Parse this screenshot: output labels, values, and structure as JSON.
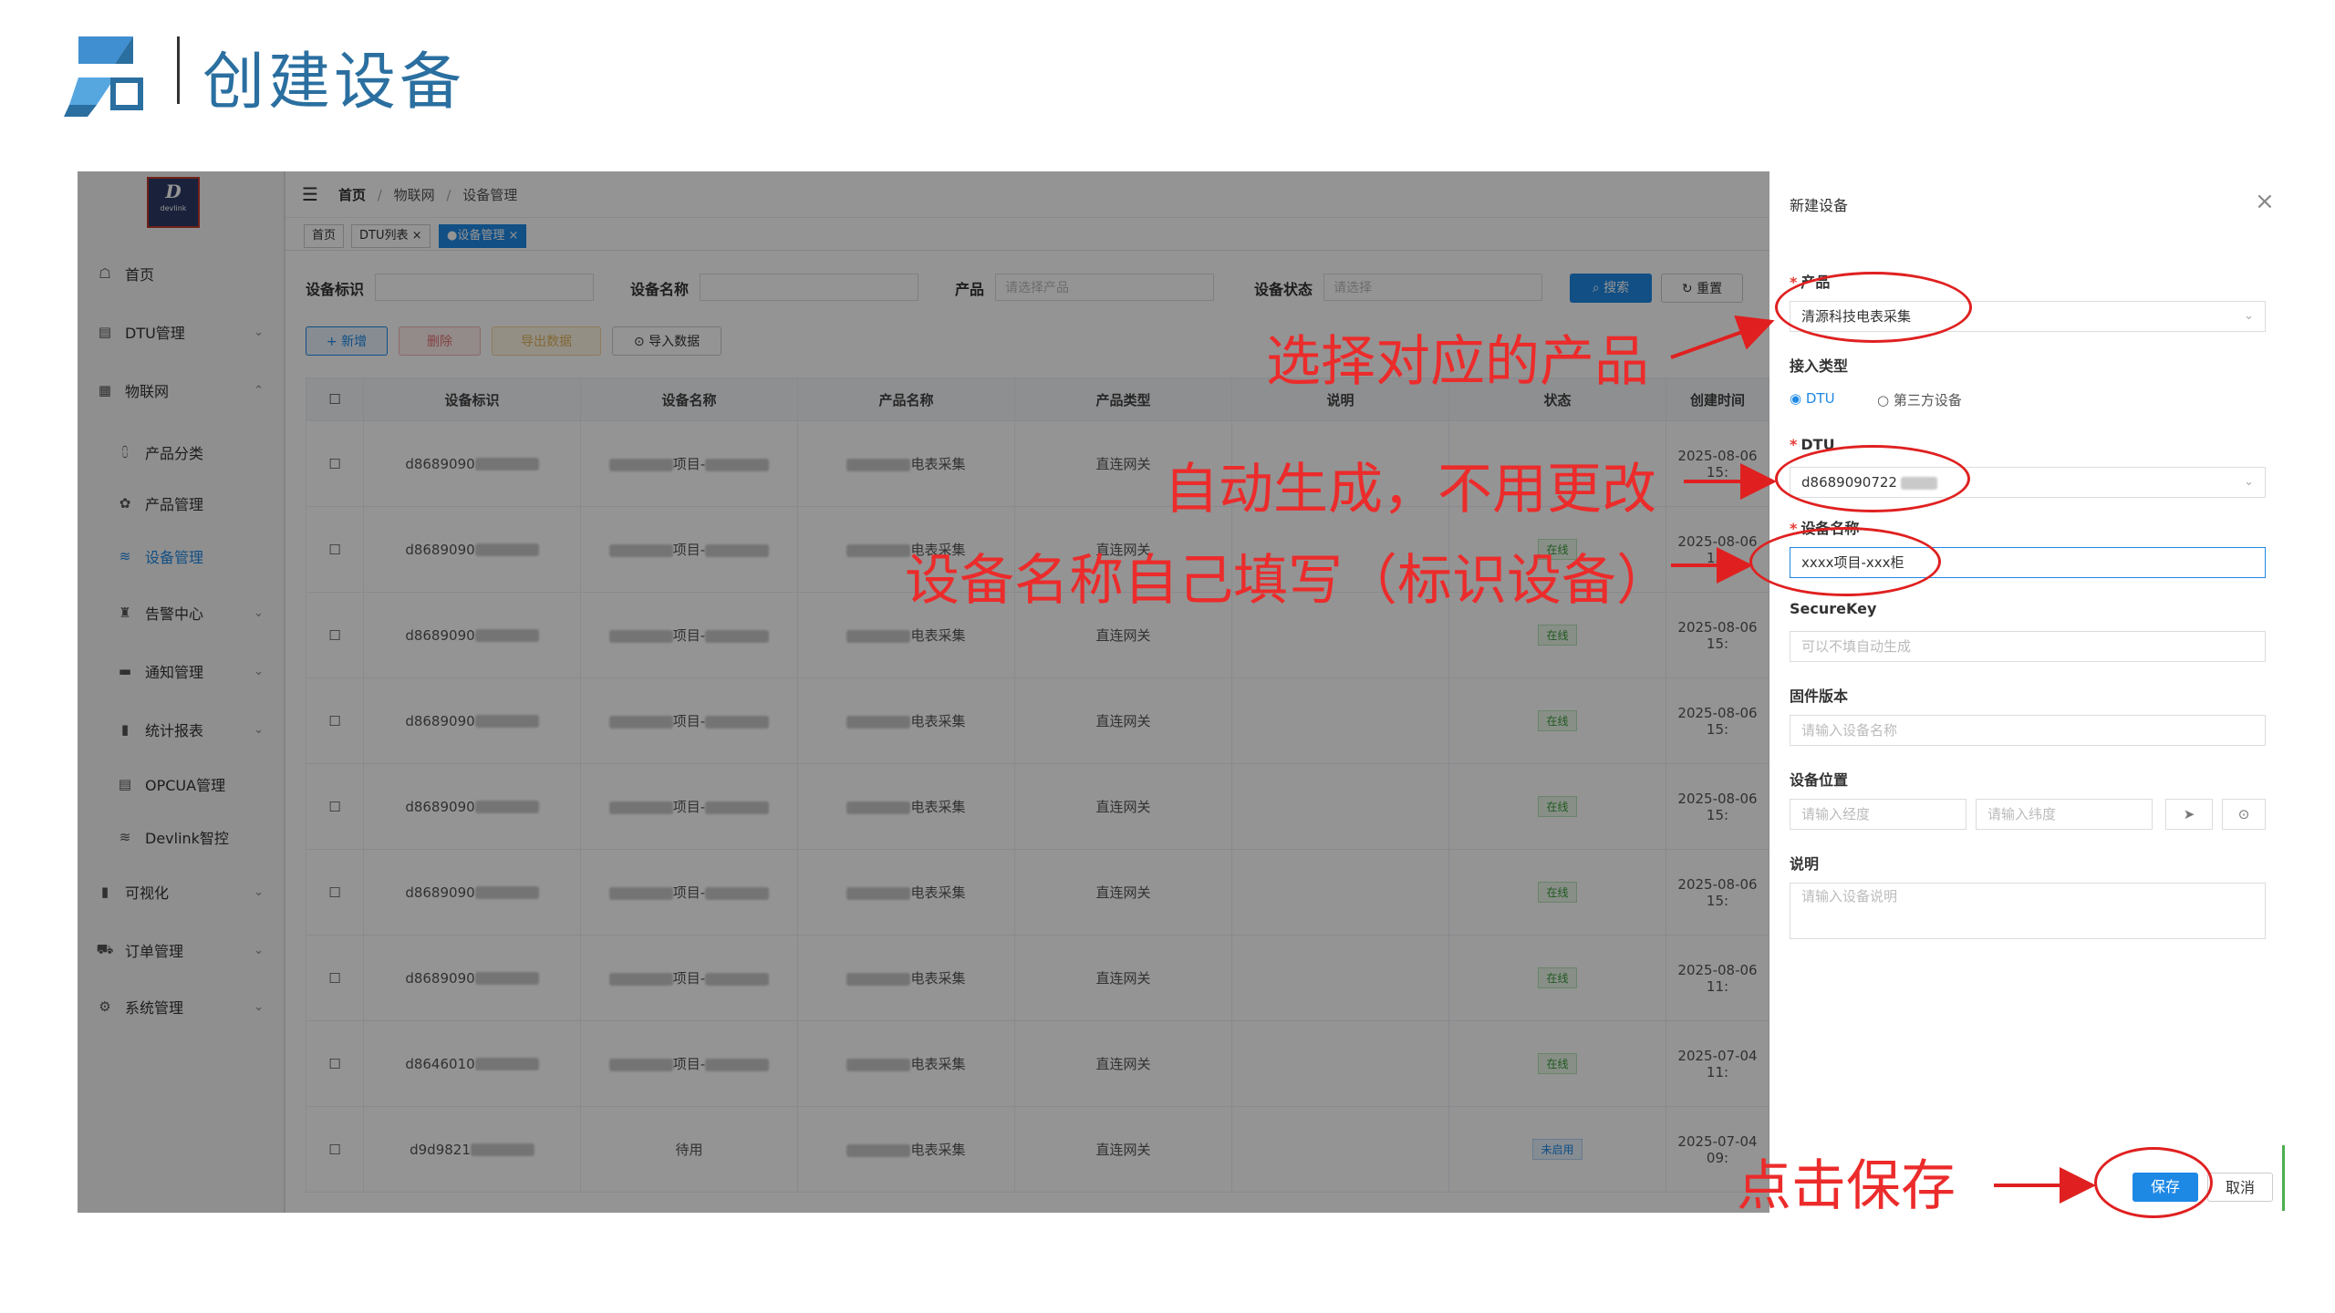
{
  "slide": {
    "title": "创建设备"
  },
  "sidebar": {
    "logo_letter": "D",
    "logo_text": "devlink",
    "items": [
      {
        "icon": "dashboard-icon",
        "glyph": "☖",
        "label": "首页"
      },
      {
        "icon": "dtu-icon",
        "glyph": "▤",
        "label": "DTU管理",
        "chev": "⌄"
      },
      {
        "icon": "iot-icon",
        "glyph": "▦",
        "label": "物联网",
        "chev": "⌃"
      },
      {
        "icon": "product-category-icon",
        "glyph": "⩇",
        "label": "产品分类"
      },
      {
        "icon": "product-manage-icon",
        "glyph": "✿",
        "label": "产品管理"
      },
      {
        "icon": "device-manage-icon",
        "glyph": "≋",
        "label": "设备管理"
      },
      {
        "icon": "alarm-icon",
        "glyph": "♜",
        "label": "告警中心",
        "chev": "⌄"
      },
      {
        "icon": "notice-icon",
        "glyph": "▬",
        "label": "通知管理",
        "chev": "⌄"
      },
      {
        "icon": "report-icon",
        "glyph": "▮",
        "label": "统计报表",
        "chev": "⌄"
      },
      {
        "icon": "opcua-icon",
        "glyph": "▤",
        "label": "OPCUA管理"
      },
      {
        "icon": "devlink-control-icon",
        "glyph": "≋",
        "label": "Devlink智控"
      },
      {
        "icon": "visual-icon",
        "glyph": "▮",
        "label": "可视化",
        "chev": "⌄"
      },
      {
        "icon": "order-icon",
        "glyph": "⛟",
        "label": "订单管理",
        "chev": "⌄"
      },
      {
        "icon": "system-icon",
        "glyph": "⚙",
        "label": "系统管理",
        "chev": "⌄"
      }
    ]
  },
  "header": {
    "menu_glyph": "☰",
    "breadcrumb": [
      "首页",
      "物联网",
      "设备管理"
    ],
    "sep": "/",
    "tabs": [
      "首页",
      "DTU列表 ×",
      "●设备管理 ×"
    ]
  },
  "filters": {
    "device_id_label": "设备标识",
    "device_name_label": "设备名称",
    "product_label": "产品",
    "product_placeholder": "请选择产品",
    "status_label": "设备状态",
    "status_placeholder": "请选择",
    "search_label": "搜索",
    "reset_label": "重置"
  },
  "toolbar": {
    "add": "+ 新增",
    "delete": "删除",
    "export": "导出数据",
    "import": "导入数据"
  },
  "table": {
    "headers": [
      "",
      "设备标识",
      "设备名称",
      "产品名称",
      "产品类型",
      "说明",
      "状态",
      "创建时间"
    ],
    "rows": [
      {
        "id": "d8689090",
        "name": "项目-",
        "product": "电表采集",
        "ptype": "直连网关",
        "status": "",
        "time": "2025-08-06 15:"
      },
      {
        "id": "d8689090",
        "name": "项目-",
        "product": "电表采集",
        "ptype": "直连网关",
        "status": "在线",
        "time": "2025-08-06 15:"
      },
      {
        "id": "d8689090",
        "name": "项目-",
        "product": "电表采集",
        "ptype": "直连网关",
        "status": "在线",
        "time": "2025-08-06 15:"
      },
      {
        "id": "d8689090",
        "name": "项目-",
        "product": "电表采集",
        "ptype": "直连网关",
        "status": "在线",
        "time": "2025-08-06 15:"
      },
      {
        "id": "d8689090",
        "name": "项目-",
        "product": "电表采集",
        "ptype": "直连网关",
        "status": "在线",
        "time": "2025-08-06 15:"
      },
      {
        "id": "d8689090",
        "name": "项目-",
        "product": "电表采集",
        "ptype": "直连网关",
        "status": "在线",
        "time": "2025-08-06 15:"
      },
      {
        "id": "d8689090",
        "name": "项目-",
        "product": "电表采集",
        "ptype": "直连网关",
        "status": "在线",
        "time": "2025-08-06 11:"
      },
      {
        "id": "d8646010",
        "name": "项目-",
        "product": "电表采集",
        "ptype": "直连网关",
        "status": "在线",
        "time": "2025-07-04 11:"
      },
      {
        "id": "d9d9821",
        "name": "待用",
        "product": "电表采集",
        "ptype": "直连网关",
        "status": "未启用",
        "time": "2025-07-04 09:"
      }
    ]
  },
  "drawer": {
    "title": "新建设备",
    "close": "×",
    "product_label": "产品",
    "product_value": "清源科技电表采集",
    "access_label": "接入类型",
    "access_options": [
      "DTU",
      "第三方设备"
    ],
    "dtu_label": "DTU",
    "dtu_value": "d8689090722",
    "name_label": "设备名称",
    "name_value": "xxxx项目-xxx柜",
    "securekey_label": "SecureKey",
    "securekey_placeholder": "可以不填自动生成",
    "firmware_label": "固件版本",
    "firmware_placeholder": "请输入设备名称",
    "location_label": "设备位置",
    "lng_placeholder": "请输入经度",
    "lat_placeholder": "请输入纬度",
    "desc_label": "说明",
    "desc_placeholder": "请输入设备说明",
    "save_label": "保存",
    "cancel_label": "取消"
  },
  "annotations": {
    "select_product": "选择对应的产品",
    "auto_generate": "自动生成，不用更改",
    "fill_name": "设备名称自己填写（标识设备）",
    "click_save": "点击保存"
  },
  "colors": {
    "accent": "#1e88e5",
    "annotation": "#e02020",
    "title": "#2a6fa0"
  }
}
